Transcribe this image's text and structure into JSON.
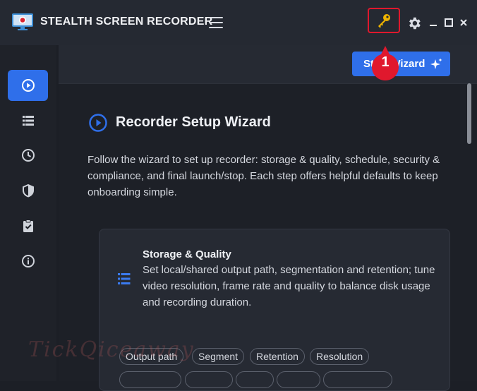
{
  "app": {
    "title": "STEALTH SCREEN RECORDER"
  },
  "toolbar": {
    "start_wizard_label": "Start Wizard",
    "callout_number": "1"
  },
  "colors": {
    "accent": "#2f6fea",
    "highlight": "#e0182d",
    "key": "#f0b400"
  },
  "sidebar": {
    "items": [
      {
        "icon": "play-circle-icon",
        "active": true
      },
      {
        "icon": "list-icon",
        "active": false
      },
      {
        "icon": "clock-icon",
        "active": false
      },
      {
        "icon": "shield-icon",
        "active": false
      },
      {
        "icon": "clipboard-check-icon",
        "active": false
      },
      {
        "icon": "info-icon",
        "active": false
      }
    ]
  },
  "main": {
    "section_title": "Recorder Setup Wizard",
    "intro": "Follow the wizard to set up recorder: storage & quality, schedule, security & compliance, and final launch/stop. Each step offers helpful defaults to keep onboarding simple.",
    "card": {
      "title": "Storage & Quality",
      "description": "Set local/shared output path, segmentation and retention; tune video resolution, frame rate and quality to balance disk usage and recording duration.",
      "chips": [
        "Output path",
        "Segment",
        "Retention",
        "Resolution"
      ]
    }
  },
  "watermark": "TickQiceaway"
}
